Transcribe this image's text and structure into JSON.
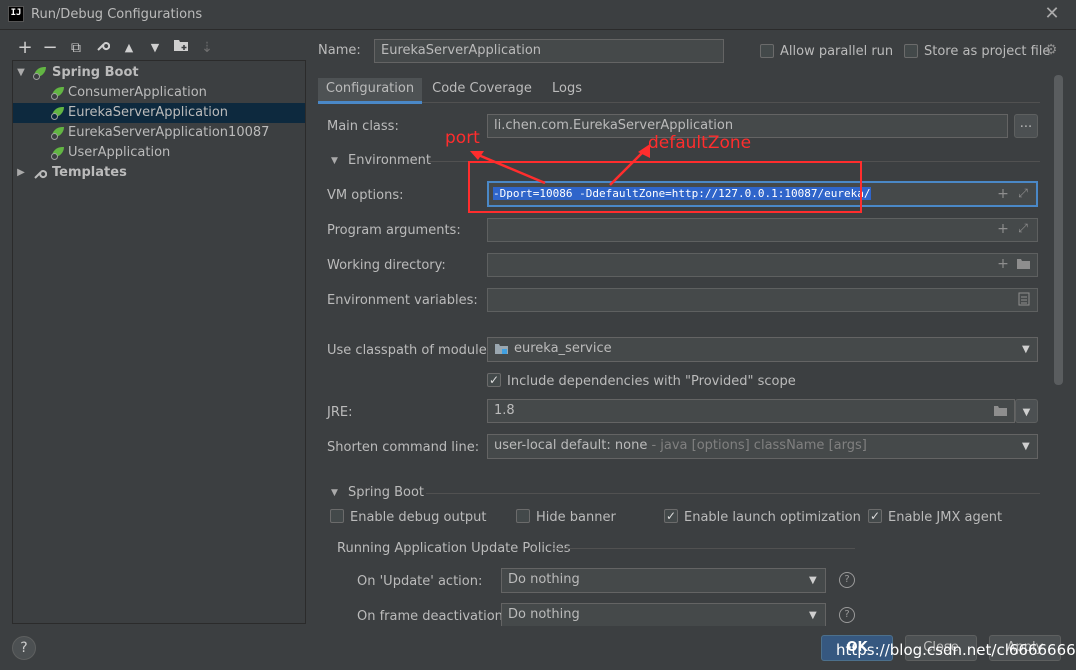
{
  "window": {
    "title": "Run/Debug Configurations",
    "logo_text": "IJ"
  },
  "toolbar": {
    "add": "+",
    "remove": "−",
    "copy": "⧉",
    "edit": "🔧",
    "move_up": "▲",
    "move_down": "▼",
    "folder": "▆",
    "sort": "⇣"
  },
  "tree": {
    "spring_boot": "Spring Boot",
    "items": [
      "ConsumerApplication",
      "EurekaServerApplication",
      "EurekaServerApplication10087",
      "UserApplication"
    ],
    "templates": "Templates"
  },
  "header": {
    "name_label": "Name:",
    "name_value": "EurekaServerApplication",
    "allow_parallel": "Allow parallel run",
    "store_as_project": "Store as project file"
  },
  "tabs": [
    "Configuration",
    "Code Coverage",
    "Logs"
  ],
  "config": {
    "main_class_label": "Main class:",
    "main_class_value": "li.chen.com.EurekaServerApplication",
    "browse": "...",
    "environment_section": "Environment",
    "vm_options_label": "VM options:",
    "vm_options_value": "-Dport=10086 -DdefaultZone=http://127.0.0.1:10087/eureka/",
    "program_args_label": "Program arguments:",
    "working_dir_label": "Working directory:",
    "env_vars_label": "Environment variables:",
    "classpath_label": "Use classpath of module:",
    "classpath_value": "eureka_service",
    "include_deps": "Include dependencies with \"Provided\" scope",
    "jre_label": "JRE:",
    "jre_value": "1.8",
    "shorten_label": "Shorten command line:",
    "shorten_value": "user-local default: none",
    "shorten_hint": " - java [options] className [args]"
  },
  "spring_boot": {
    "section": "Spring Boot",
    "debug_output": "Enable debug output",
    "hide_banner": "Hide banner",
    "launch_opt": "Enable launch optimization",
    "jmx_agent": "Enable JMX agent",
    "policies_title": "Running Application Update Policies",
    "on_update_label": "On 'Update' action:",
    "on_update_value": "Do nothing",
    "on_frame_label": "On frame deactivation:",
    "on_frame_value": "Do nothing"
  },
  "annotations": {
    "port": "port",
    "default_zone": "defaultZone"
  },
  "footer": {
    "help": "?",
    "ok": "OK",
    "close": "Close",
    "apply": "Apply"
  },
  "watermark": "https://blog.csdn.net/cl66666666",
  "colors": {
    "accent": "#4a88c7",
    "annotation": "#ff2d2d",
    "selection": "#0d293e",
    "ok_button": "#365880",
    "spring_leaf": "#62b543"
  }
}
